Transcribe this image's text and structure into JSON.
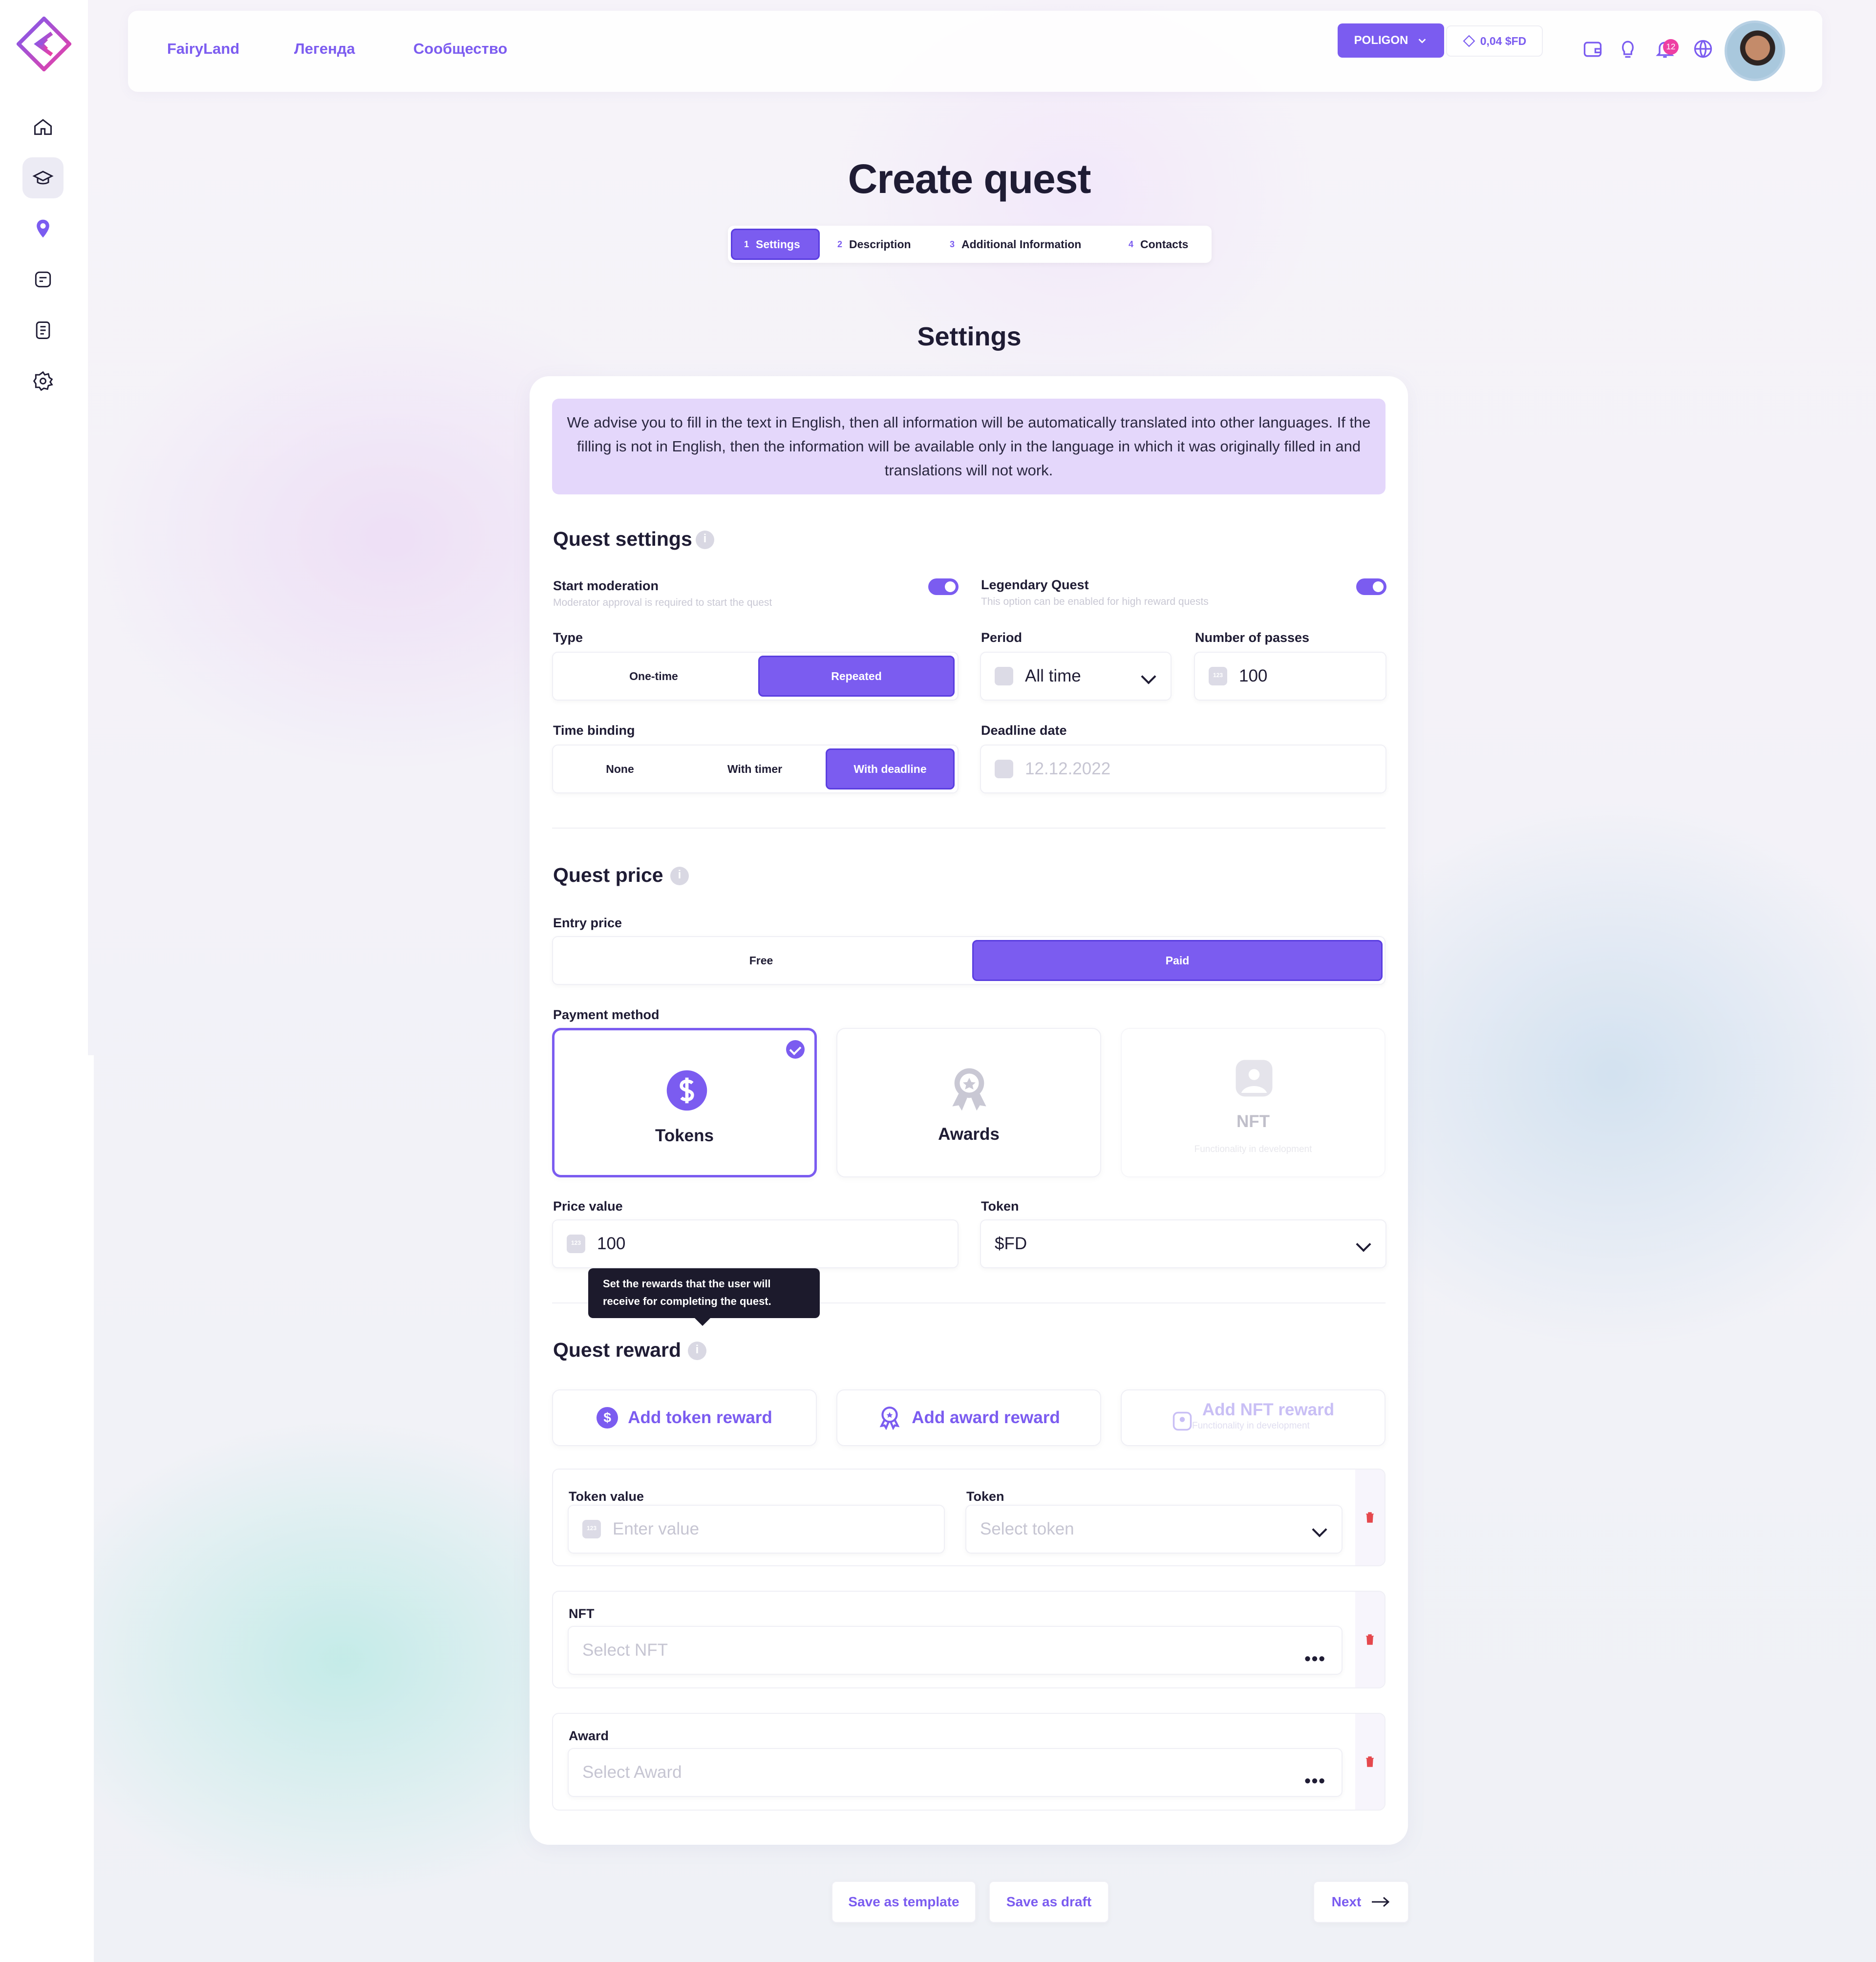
{
  "header": {
    "nav": [
      "FairyLand",
      "Легенда",
      "Сообщество"
    ],
    "network": "POLIGON",
    "balance": "0,04 $FD",
    "notifications_count": "12",
    "icons": [
      "wallet-icon",
      "lightbulb-icon",
      "bell-icon",
      "globe-icon"
    ]
  },
  "sidebar": {
    "icons": [
      "home-icon",
      "graduation-cap-icon",
      "location-pin-icon",
      "quest-icon",
      "list-icon",
      "settings-icon"
    ],
    "active": "graduation-cap-icon"
  },
  "page": {
    "title": "Create quest",
    "section_title": "Settings"
  },
  "steps": [
    {
      "num": "1",
      "label": "Settings"
    },
    {
      "num": "2",
      "label": "Description"
    },
    {
      "num": "3",
      "label": "Additional Information"
    },
    {
      "num": "4",
      "label": "Contacts"
    }
  ],
  "notice": "We advise you to fill in the text in English, then all information will be automatically translated into other languages. If the filling is not in English, then the information will be available only in the language in which it was originally filled in and translations will not work.",
  "quest_settings": {
    "title": "Quest settings",
    "start_moderation": {
      "label": "Start moderation",
      "hint": "Moderator approval is required to start the quest",
      "on": true
    },
    "legendary": {
      "label": "Legendary Quest",
      "hint": "This option can be enabled for high reward quests",
      "on": true
    },
    "type": {
      "label": "Type",
      "options": [
        "One-time",
        "Repeated"
      ],
      "selected": "Repeated"
    },
    "period": {
      "label": "Period",
      "value": "All time"
    },
    "passes": {
      "label": "Number of passes",
      "value": "100"
    },
    "time_binding": {
      "label": "Time binding",
      "options": [
        "None",
        "With timer",
        "With deadline"
      ],
      "selected": "With deadline"
    },
    "deadline": {
      "label": "Deadline date",
      "placeholder": "12.12.2022"
    }
  },
  "quest_price": {
    "title": "Quest price",
    "entry": {
      "label": "Entry price",
      "options": [
        "Free",
        "Paid"
      ],
      "selected": "Paid"
    },
    "payment_label": "Payment method",
    "methods": [
      {
        "label": "Tokens",
        "sub": ""
      },
      {
        "label": "Awards",
        "sub": ""
      },
      {
        "label": "NFT",
        "sub": "Functionality in development"
      }
    ],
    "price_value": {
      "label": "Price value",
      "value": "100"
    },
    "token": {
      "label": "Token",
      "value": "$FD"
    }
  },
  "tooltip": "Set the rewards that the user will receive for completing the quest.",
  "quest_reward": {
    "title": "Quest reward",
    "add_token": "Add token reward",
    "add_award": "Add award reward",
    "add_nft": "Add NFT reward",
    "add_nft_sub": "Functionality in development",
    "token_value": {
      "label": "Token value",
      "placeholder": "Enter value"
    },
    "token": {
      "label": "Token",
      "placeholder": "Select token"
    },
    "nft": {
      "label": "NFT",
      "placeholder": "Select NFT"
    },
    "award": {
      "label": "Award",
      "placeholder": "Select Award"
    }
  },
  "footer": {
    "save_template": "Save as template",
    "save_draft": "Save as draft",
    "next": "Next"
  },
  "colors": {
    "accent": "#7b5cf0",
    "badge": "#ee3fa3",
    "notice_bg": "#e4d7fb",
    "danger": "#e5484d"
  }
}
